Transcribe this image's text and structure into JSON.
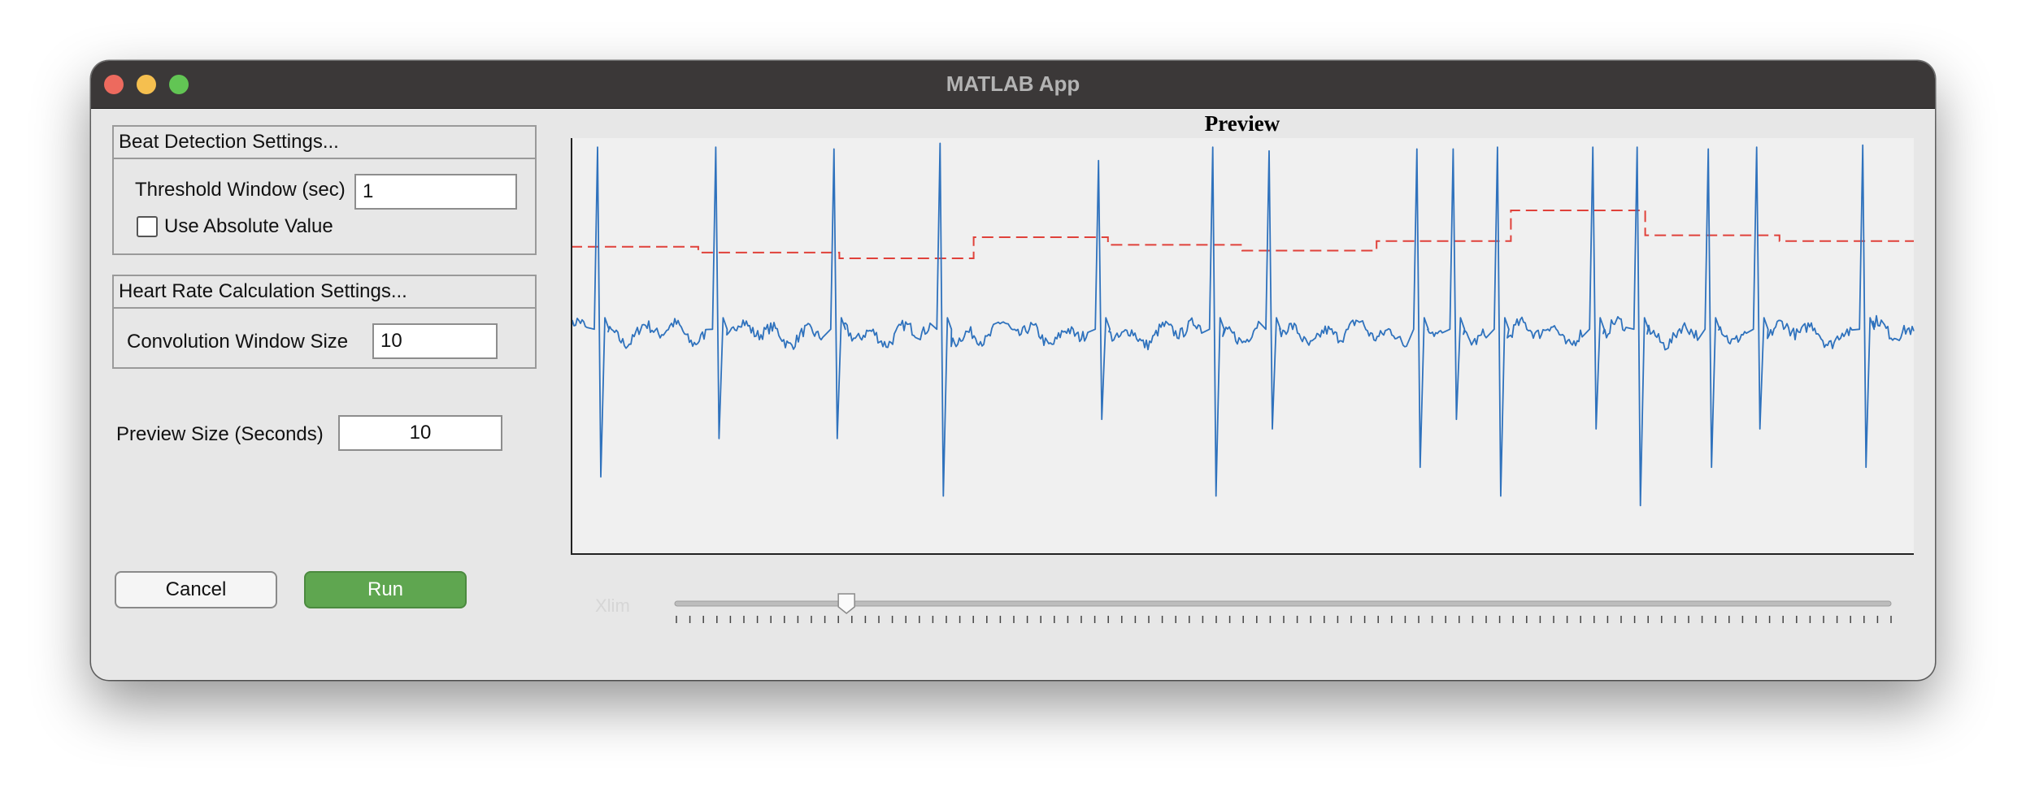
{
  "window": {
    "title": "MATLAB App"
  },
  "beat_detection": {
    "header": "Beat Detection Settings...",
    "threshold_label": "Threshold Window (sec)",
    "threshold_value": "1",
    "absolute_label": "Use Absolute Value",
    "absolute_checked": false
  },
  "heart_rate": {
    "header": "Heart Rate Calculation Settings...",
    "conv_label": "Convolution Window Size",
    "conv_value": "10"
  },
  "preview_size": {
    "label": "Preview Size (Seconds)",
    "value": "10"
  },
  "buttons": {
    "cancel": "Cancel",
    "run": "Run"
  },
  "plot": {
    "title": "Preview",
    "signal_color": "#2f72bd",
    "threshold_color": "#e0413a",
    "background": "#f0f0f0",
    "beat_times": [
      0.02,
      0.108,
      0.196,
      0.275,
      0.393,
      0.478,
      0.52,
      0.63,
      0.657,
      0.69,
      0.761,
      0.794,
      0.847,
      0.883,
      0.962
    ],
    "beat_up": [
      0.97,
      0.97,
      0.96,
      0.99,
      0.9,
      0.97,
      0.95,
      0.96,
      0.96,
      0.97,
      0.97,
      0.97,
      0.96,
      0.97,
      0.98
    ],
    "beat_down": [
      -0.75,
      -0.55,
      -0.55,
      -0.85,
      -0.45,
      -0.85,
      -0.5,
      -0.7,
      -0.45,
      -0.85,
      -0.5,
      -0.9,
      -0.7,
      -0.5,
      -0.7
    ],
    "threshold_steps": [
      {
        "start": 0.0,
        "end": 0.095,
        "level": 0.45
      },
      {
        "start": 0.095,
        "end": 0.2,
        "level": 0.42
      },
      {
        "start": 0.2,
        "end": 0.3,
        "level": 0.39
      },
      {
        "start": 0.3,
        "end": 0.4,
        "level": 0.5
      },
      {
        "start": 0.4,
        "end": 0.5,
        "level": 0.46
      },
      {
        "start": 0.5,
        "end": 0.6,
        "level": 0.43
      },
      {
        "start": 0.6,
        "end": 0.7,
        "level": 0.48
      },
      {
        "start": 0.7,
        "end": 0.8,
        "level": 0.64
      },
      {
        "start": 0.8,
        "end": 0.9,
        "level": 0.51
      },
      {
        "start": 0.9,
        "end": 1.0,
        "level": 0.48
      }
    ]
  },
  "slider": {
    "label": "Xlim",
    "value": 0.14,
    "tick_count": 90
  }
}
